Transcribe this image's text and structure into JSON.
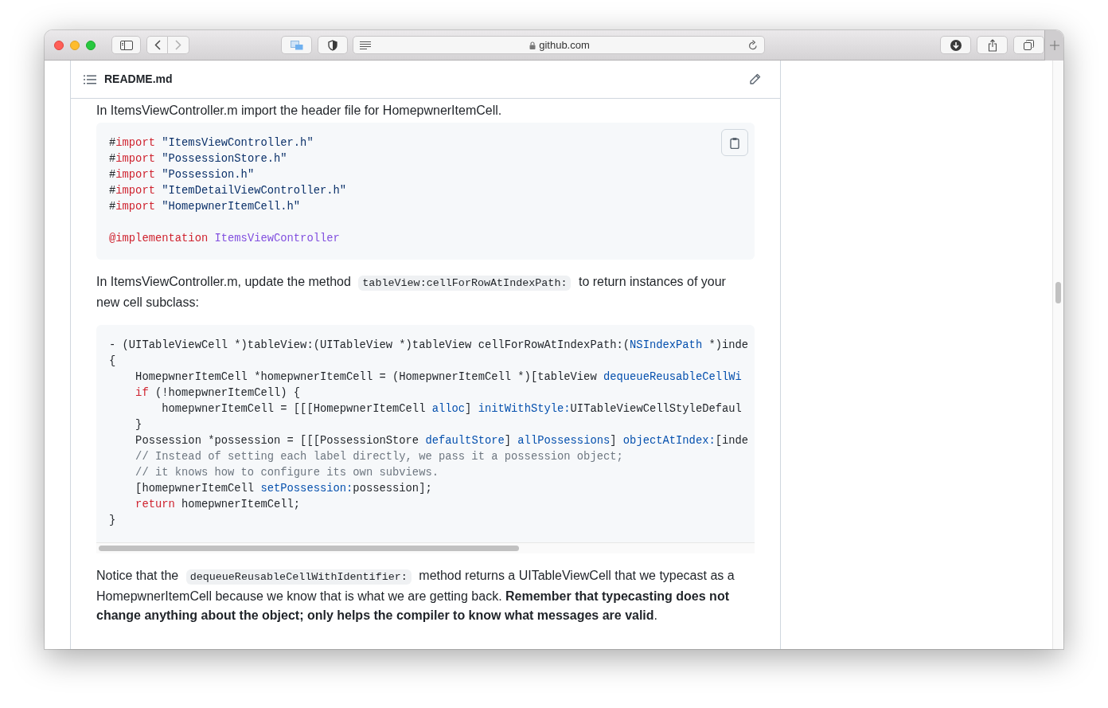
{
  "browser": {
    "address": "github.com",
    "back_disabled": false,
    "forward_disabled": true
  },
  "file_header": {
    "title": "README.md"
  },
  "content": [
    {
      "kind": "paragraph",
      "parts": [
        {
          "kind": "text",
          "text": "In ItemsViewController.m import the header file for HomepwnerItemCell."
        }
      ]
    },
    {
      "kind": "code",
      "copy_button": true,
      "lines": [
        {
          "kind": "code",
          "tokens": [
            {
              "kind": "plain",
              "text": "#"
            },
            {
              "kind": "keyword",
              "text": "import"
            },
            {
              "kind": "string",
              "text": " \"ItemsViewController.h\""
            }
          ]
        },
        {
          "kind": "code",
          "tokens": [
            {
              "kind": "plain",
              "text": "#"
            },
            {
              "kind": "keyword",
              "text": "import"
            },
            {
              "kind": "string",
              "text": " \"PossessionStore.h\""
            }
          ]
        },
        {
          "kind": "code",
          "tokens": [
            {
              "kind": "plain",
              "text": "#"
            },
            {
              "kind": "keyword",
              "text": "import"
            },
            {
              "kind": "string",
              "text": " \"Possession.h\""
            }
          ]
        },
        {
          "kind": "code",
          "tokens": [
            {
              "kind": "plain",
              "text": "#"
            },
            {
              "kind": "keyword",
              "text": "import"
            },
            {
              "kind": "string",
              "text": " \"ItemDetailViewController.h\""
            }
          ]
        },
        {
          "kind": "code",
          "tokens": [
            {
              "kind": "plain",
              "text": "#"
            },
            {
              "kind": "keyword",
              "text": "import"
            },
            {
              "kind": "string",
              "text": " \"HomepwnerItemCell.h\""
            }
          ]
        },
        {
          "kind": "blank"
        },
        {
          "kind": "code",
          "tokens": [
            {
              "kind": "keyword",
              "text": "@implementation"
            },
            {
              "kind": "entity",
              "text": " ItemsViewController"
            }
          ]
        }
      ]
    },
    {
      "kind": "paragraph",
      "parts": [
        {
          "kind": "text",
          "text": "In ItemsViewController.m, update the method"
        },
        {
          "kind": "code",
          "text": "tableView:cellForRowAtIndexPath:"
        },
        {
          "kind": "text",
          "text": "to return instances of your new cell subclass:"
        }
      ]
    },
    {
      "kind": "code",
      "scrollbar": true,
      "lines": [
        {
          "kind": "code",
          "tokens": [
            {
              "kind": "plain",
              "text": "- (UITableViewCell *)tableView:(UITableView *)tableView cellForRowAtIndexPath:("
            },
            {
              "kind": "func",
              "text": "NSIndexPath"
            },
            {
              "kind": "plain",
              "text": " *)inde"
            }
          ]
        },
        {
          "kind": "code",
          "tokens": [
            {
              "kind": "plain",
              "text": "{"
            }
          ]
        },
        {
          "kind": "code",
          "tokens": [
            {
              "kind": "plain",
              "text": "    HomepwnerItemCell *homepwnerItemCell = (HomepwnerItemCell *)[tableView "
            },
            {
              "kind": "func",
              "text": "dequeueReusableCellWi"
            }
          ]
        },
        {
          "kind": "code",
          "tokens": [
            {
              "kind": "keyword",
              "text": "    if"
            },
            {
              "kind": "plain",
              "text": " (!homepwnerItemCell) {"
            }
          ]
        },
        {
          "kind": "code",
          "tokens": [
            {
              "kind": "plain",
              "text": "        homepwnerItemCell = [[[HomepwnerItemCell "
            },
            {
              "kind": "func",
              "text": "alloc"
            },
            {
              "kind": "plain",
              "text": "] "
            },
            {
              "kind": "func",
              "text": "initWithStyle:"
            },
            {
              "kind": "plain",
              "text": "UITableViewCellStyleDefaul"
            }
          ]
        },
        {
          "kind": "code",
          "tokens": [
            {
              "kind": "plain",
              "text": "    }"
            }
          ]
        },
        {
          "kind": "code",
          "tokens": [
            {
              "kind": "plain",
              "text": "    Possession *possession = [[[PossessionStore "
            },
            {
              "kind": "func",
              "text": "defaultStore"
            },
            {
              "kind": "plain",
              "text": "] "
            },
            {
              "kind": "func",
              "text": "allPossessions"
            },
            {
              "kind": "plain",
              "text": "] "
            },
            {
              "kind": "func",
              "text": "objectAtIndex:"
            },
            {
              "kind": "plain",
              "text": "[inde"
            }
          ]
        },
        {
          "kind": "code",
          "tokens": [
            {
              "kind": "comment",
              "text": "    // Instead of setting each label directly, we pass it a possession object;"
            }
          ]
        },
        {
          "kind": "code",
          "tokens": [
            {
              "kind": "comment",
              "text": "    // it knows how to configure its own subviews."
            }
          ]
        },
        {
          "kind": "code",
          "tokens": [
            {
              "kind": "plain",
              "text": "    [homepwnerItemCell "
            },
            {
              "kind": "func",
              "text": "setPossession:"
            },
            {
              "kind": "plain",
              "text": "possession];"
            }
          ]
        },
        {
          "kind": "code",
          "tokens": [
            {
              "kind": "keyword",
              "text": "    return"
            },
            {
              "kind": "plain",
              "text": " homepwnerItemCell;"
            }
          ]
        },
        {
          "kind": "code",
          "tokens": [
            {
              "kind": "plain",
              "text": "}"
            }
          ]
        }
      ]
    },
    {
      "kind": "paragraph",
      "parts": [
        {
          "kind": "text",
          "text": "Notice that the"
        },
        {
          "kind": "code",
          "text": "dequeueReusableCellWithIdentifier:"
        },
        {
          "kind": "text",
          "text": "method returns a UITableViewCell that we typecast as a HomepwnerItemCell because we know that is what we are getting back. **Remember that typecasting does not change anything about the object; only helps the compiler to know what messages are valid**."
        }
      ]
    }
  ]
}
